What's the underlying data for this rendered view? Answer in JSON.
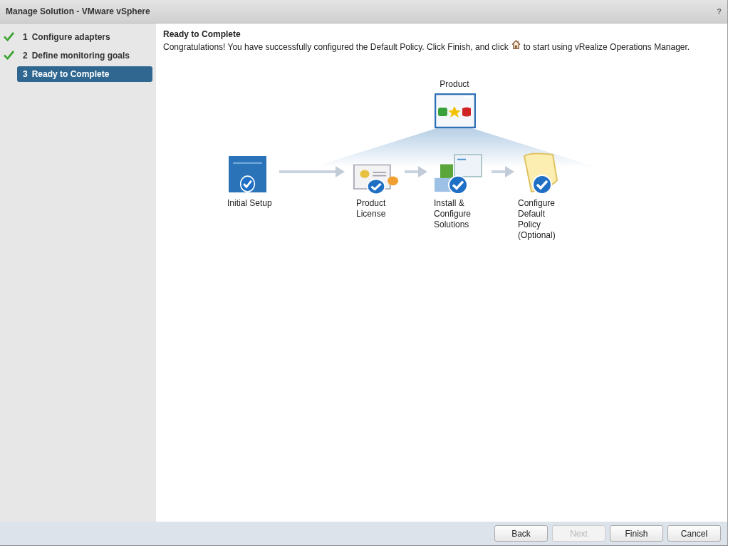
{
  "window": {
    "title": "Manage Solution - VMware vSphere",
    "help": "?"
  },
  "steps": [
    {
      "number": "1",
      "label": "Configure adapters",
      "completed": true,
      "selected": false
    },
    {
      "number": "2",
      "label": "Define monitoring goals",
      "completed": true,
      "selected": false
    },
    {
      "number": "3",
      "label": "Ready to Complete",
      "completed": false,
      "selected": true
    }
  ],
  "page": {
    "heading": "Ready to Complete",
    "message_before": "Congratulations! You have successfully configured the Default Policy. Click Finish, and click",
    "message_after": "to start using vRealize Operations Manager."
  },
  "diagram": {
    "product_label": "Product",
    "nodes": [
      {
        "kind": "setup",
        "label": "Initial Setup",
        "checked": true
      },
      {
        "kind": "license",
        "label": "Product License",
        "checked": true
      },
      {
        "kind": "solutions",
        "label": "Install & Configure Solutions",
        "checked": true
      },
      {
        "kind": "policy",
        "label": "Configure Default Policy (Optional)",
        "checked": true
      }
    ]
  },
  "buttons": [
    {
      "label": "Back",
      "disabled": false
    },
    {
      "label": "Next",
      "disabled": true
    },
    {
      "label": "Finish",
      "disabled": false
    },
    {
      "label": "Cancel",
      "disabled": false
    }
  ]
}
